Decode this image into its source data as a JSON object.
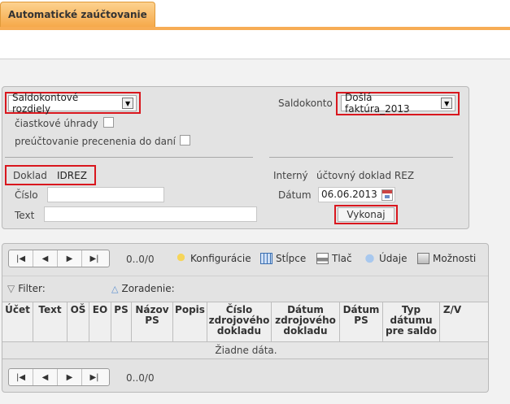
{
  "tab": {
    "title": "Automatické zaúčtovanie"
  },
  "filter": {
    "type_select": "Saldokontové rozdiely",
    "partial_payments_label": "čiastkové úhrady",
    "revaluation_label": "preúčtovanie precenenia do daní",
    "saldokonto_label": "Saldokonto",
    "saldokonto_select": "Došlá faktúra_2013",
    "doklad_label": "Doklad",
    "doklad_value": "IDREZ",
    "internal_doc_label": "Interný",
    "internal_doc_value": "účtovný doklad REZ",
    "cislo_label": "Číslo",
    "text_label": "Text",
    "datum_label": "Dátum",
    "datum_value": "06.06.2013",
    "execute_button": "Vykonaj"
  },
  "toolbar": {
    "page_info": "0..0/0",
    "configurations": "Konfigurácie",
    "columns": "Stĺpce",
    "print": "Tlač",
    "data": "Údaje",
    "options": "Možnosti"
  },
  "filter_bar": {
    "filter_label": "Filter:",
    "sort_label": "Zoradenie:"
  },
  "grid": {
    "columns": [
      {
        "l1": "Účet",
        "l2": "",
        "l3": "",
        "l4": ""
      },
      {
        "l1": "Text",
        "l2": "",
        "l3": "",
        "l4": ""
      },
      {
        "l1": "OŠ",
        "l2": "",
        "l3": "",
        "l4": ""
      },
      {
        "l1": "EO",
        "l2": "",
        "l3": "",
        "l4": ""
      },
      {
        "l1": "PS",
        "l2": "",
        "l3": "",
        "l4": ""
      },
      {
        "l1": "Názov",
        "l2": "PS",
        "l3": "",
        "l4": ""
      },
      {
        "l1": "Popis",
        "l2": "",
        "l3": "",
        "l4": ""
      },
      {
        "l1": "Číslo",
        "l2": "zdrojového",
        "l3": "dokladu",
        "l4": ""
      },
      {
        "l1": "Dátum",
        "l2": "zdrojového",
        "l3": "dokladu",
        "l4": ""
      },
      {
        "l1": "Dátum",
        "l2": "PS",
        "l3": "",
        "l4": ""
      },
      {
        "l1": "Typ",
        "l2": "dátumu",
        "l3": "pre saldo",
        "l4": ""
      },
      {
        "l1": "Z/V",
        "l2": "",
        "l3": "",
        "l4": ""
      }
    ],
    "empty_text": "Žiadne dáta."
  },
  "bottom_pager": {
    "page_info": "0..0/0"
  }
}
